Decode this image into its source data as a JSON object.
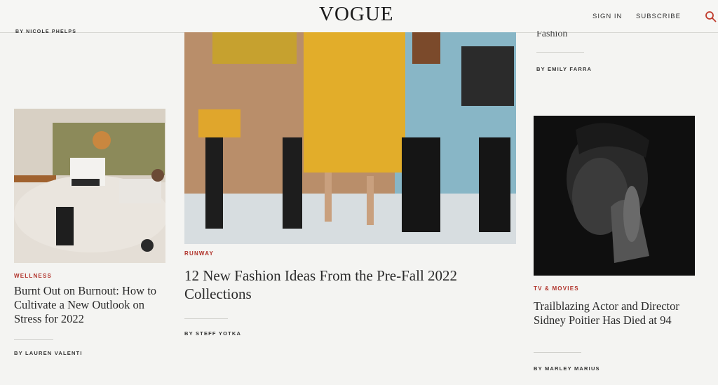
{
  "header": {
    "logo": "VOGUE",
    "sign_in": "SIGN IN",
    "subscribe": "SUBSCRIBE",
    "search_icon": "search-icon",
    "accent": "#c03a2b"
  },
  "left_column": {
    "top_byline": "BY NICOLE PHELPS",
    "article": {
      "category": "WELLNESS",
      "headline": "Burnt Out on Burnout: How to Cultivate a New Outlook on Stress for 2022",
      "byline": "BY LAUREN VALENTI"
    }
  },
  "center_column": {
    "article": {
      "category": "RUNWAY",
      "headline": "12 New Fashion Ideas From the Pre-Fall 2022 Collections",
      "byline": "BY STEFF YOTKA"
    }
  },
  "right_column": {
    "top_fragment": "Fashion",
    "top_byline": "BY EMILY FARRA",
    "article": {
      "category": "TV & MOVIES",
      "headline": "Trailblazing Actor and Director Sidney Poitier Has Died at 94",
      "byline": "BY MARLEY MARIUS"
    }
  }
}
